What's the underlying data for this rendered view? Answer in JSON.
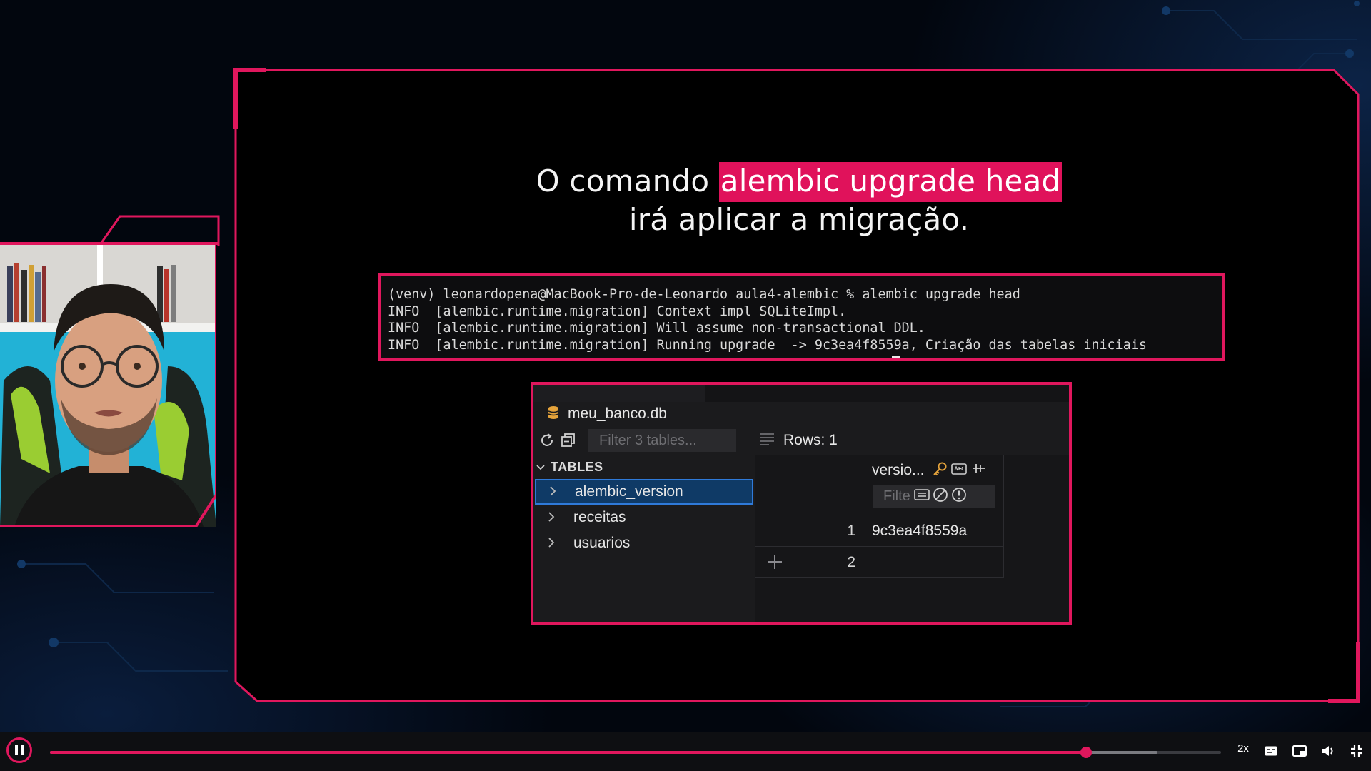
{
  "slide": {
    "title_prefix": "O comando ",
    "title_highlight": "alembic upgrade head",
    "title_line2": "irá aplicar a migração."
  },
  "terminal": {
    "lines": [
      "(venv) leonardopena@MacBook-Pro-de-Leonardo aula4-alembic % alembic upgrade head",
      "INFO  [alembic.runtime.migration] Context impl SQLiteImpl.",
      "INFO  [alembic.runtime.migration] Will assume non-transactional DDL.",
      "INFO  [alembic.runtime.migration] Running upgrade  -> 9c3ea4f8559a, Criação das tabelas iniciais"
    ]
  },
  "db_viewer": {
    "db_name": "meu_banco.db",
    "filter_placeholder": "Filter 3 tables...",
    "rows_label": "Rows: 1",
    "tables_header": "TABLES",
    "tables": [
      "alembic_version",
      "receitas",
      "usuarios"
    ],
    "selected_table": "alembic_version",
    "column_name": "versio...",
    "column_filter_placeholder": "Filte",
    "rows": [
      {
        "num": "1",
        "value": "9c3ea4f8559a"
      },
      {
        "num": "2",
        "value": ""
      }
    ]
  },
  "player": {
    "speed_label": "2x",
    "progress_fraction": 0.885,
    "buffer_fraction": 0.946,
    "state": "playing"
  },
  "colors": {
    "accent": "#e0175d",
    "selection": "#0f3a66",
    "background": "#02060e"
  }
}
